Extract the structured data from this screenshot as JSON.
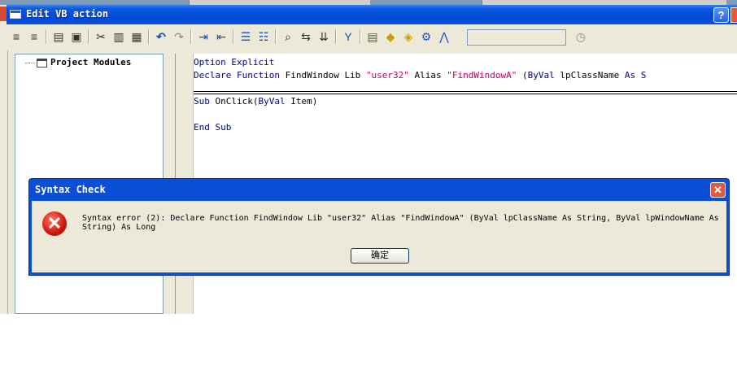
{
  "window": {
    "title": "Edit VB action",
    "help_glyph": "?"
  },
  "toolbar": {
    "icons": [
      "align-left-icon",
      "align-right-icon",
      "print-icon",
      "print-preview-icon",
      "cut-icon",
      "copy-icon",
      "paste-icon",
      "undo-icon",
      "redo-icon",
      "indent-icon",
      "outdent-icon",
      "comment-icon",
      "uncomment-icon",
      "find-icon",
      "replace-icon",
      "goto-icon",
      "debug-icon",
      "module-icon",
      "class-icon",
      "references-icon",
      "tools-icon",
      "clock-icon"
    ]
  },
  "tree": {
    "root_label": "Project Modules"
  },
  "editor": {
    "line1_kw": "Option Explicit",
    "line2": {
      "kw_declare": "Declare",
      "kw_function": "Function",
      "name": " FindWindow Lib ",
      "str_lib": "\"user32\"",
      "alias": " Alias ",
      "str_alias": "\"FindWindowA\"",
      "paren": " (",
      "kw_byval": "ByVal",
      "param": " lpClassName ",
      "kw_as": "As S"
    },
    "line3": {
      "kw_sub": "Sub",
      "rest_a": " OnClick(",
      "kw_byval": "ByVal",
      "rest_b": " Item)"
    },
    "line4": {
      "kw_end": "End Sub"
    }
  },
  "dialog": {
    "title": "Syntax Check",
    "message": "Syntax error (2): Declare Function FindWindow Lib \"user32\" Alias \"FindWindowA\" (ByVal lpClassName As String, ByVal lpWindowName As String) As Long",
    "ok_label": "确定",
    "close_glyph": "✕",
    "icon_glyph": "✕"
  },
  "colors": {
    "keyword": "#00008b",
    "string": "#c00060",
    "titlebar": "#0a58e0"
  }
}
